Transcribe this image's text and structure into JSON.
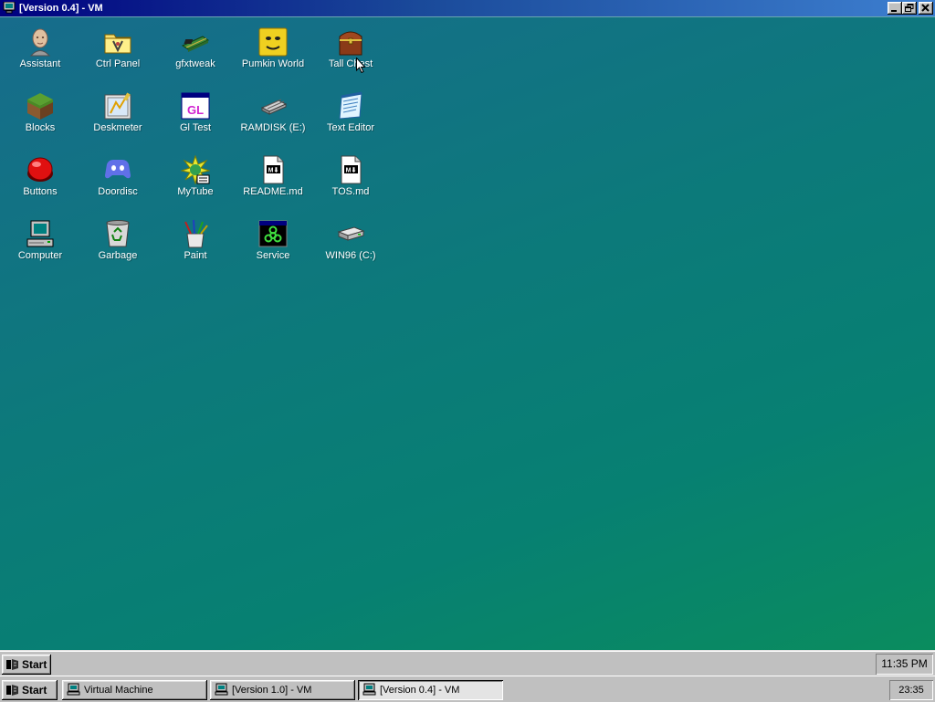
{
  "window": {
    "title": "[Version 0.4] - VM"
  },
  "desktop": {
    "icons": [
      {
        "label": "Assistant"
      },
      {
        "label": "Ctrl Panel"
      },
      {
        "label": "gfxtweak"
      },
      {
        "label": "Pumkin World"
      },
      {
        "label": "Tall Chest"
      },
      {
        "label": "Blocks"
      },
      {
        "label": "Deskmeter"
      },
      {
        "label": "Gl Test"
      },
      {
        "label": "RAMDISK (E:)"
      },
      {
        "label": "Text Editor"
      },
      {
        "label": "Buttons"
      },
      {
        "label": "Doordisc"
      },
      {
        "label": "MyTube"
      },
      {
        "label": "README.md"
      },
      {
        "label": "TOS.md"
      },
      {
        "label": "Computer"
      },
      {
        "label": "Garbage"
      },
      {
        "label": "Paint"
      },
      {
        "label": "Service"
      },
      {
        "label": "WIN96 (C:)"
      }
    ],
    "gl_glyph": "GL",
    "md_glyph": "M⬇"
  },
  "inner_taskbar": {
    "start_label": "Start",
    "clock": "11:35 PM"
  },
  "outer_taskbar": {
    "start_label": "Start",
    "tasks": [
      {
        "label": "Virtual Machine"
      },
      {
        "label": "[Version 1.0] - VM"
      },
      {
        "label": "[Version 0.4] - VM"
      }
    ],
    "clock": "23:35"
  },
  "colors": {
    "title_bar": "#000080",
    "desktop_top": "#176c8c",
    "desktop_bottom": "#0a8c5e",
    "chrome": "#c0c0c0"
  }
}
